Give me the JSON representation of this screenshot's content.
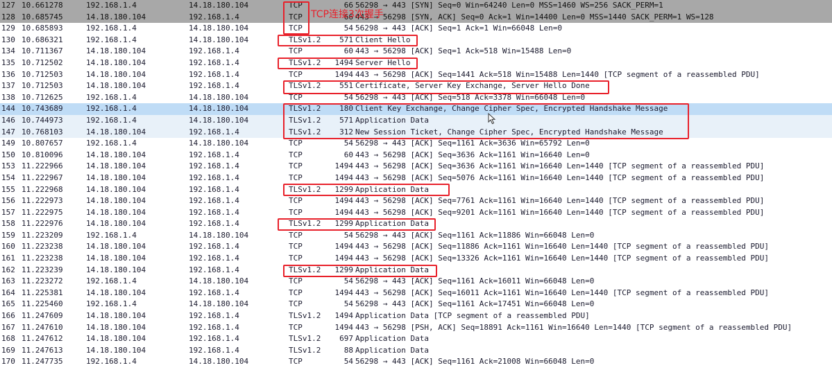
{
  "packets": [
    {
      "no": "127",
      "time": "10.661278",
      "src": "192.168.1.4",
      "dst": "14.18.180.104",
      "proto": "TCP",
      "len": "66",
      "info": "56298 → 443 [SYN] Seq=0 Win=64240 Len=0 MSS=1460 WS=256 SACK_PERM=1",
      "style": "gray"
    },
    {
      "no": "128",
      "time": "10.685745",
      "src": "14.18.180.104",
      "dst": "192.168.1.4",
      "proto": "TCP",
      "len": "66",
      "info": "443 → 56298 [SYN, ACK] Seq=0 Ack=1 Win=14400 Len=0 MSS=1440 SACK_PERM=1 WS=128",
      "style": "gray"
    },
    {
      "no": "129",
      "time": "10.685893",
      "src": "192.168.1.4",
      "dst": "14.18.180.104",
      "proto": "TCP",
      "len": "54",
      "info": "56298 → 443 [ACK] Seq=1 Ack=1 Win=66048 Len=0",
      "style": ""
    },
    {
      "no": "130",
      "time": "10.686321",
      "src": "192.168.1.4",
      "dst": "14.18.180.104",
      "proto": "TLSv1.2",
      "len": "571",
      "info": "Client Hello",
      "style": ""
    },
    {
      "no": "134",
      "time": "10.711367",
      "src": "14.18.180.104",
      "dst": "192.168.1.4",
      "proto": "TCP",
      "len": "60",
      "info": "443 → 56298 [ACK] Seq=1 Ack=518 Win=15488 Len=0",
      "style": ""
    },
    {
      "no": "135",
      "time": "10.712502",
      "src": "14.18.180.104",
      "dst": "192.168.1.4",
      "proto": "TLSv1.2",
      "len": "1494",
      "info": "Server Hello",
      "style": ""
    },
    {
      "no": "136",
      "time": "10.712503",
      "src": "14.18.180.104",
      "dst": "192.168.1.4",
      "proto": "TCP",
      "len": "1494",
      "info": "443 → 56298 [ACK] Seq=1441 Ack=518 Win=15488 Len=1440 [TCP segment of a reassembled PDU]",
      "style": ""
    },
    {
      "no": "137",
      "time": "10.712503",
      "src": "14.18.180.104",
      "dst": "192.168.1.4",
      "proto": "TLSv1.2",
      "len": "551",
      "info": "Certificate, Server Key Exchange, Server Hello Done",
      "style": ""
    },
    {
      "no": "138",
      "time": "10.712625",
      "src": "192.168.1.4",
      "dst": "14.18.180.104",
      "proto": "TCP",
      "len": "54",
      "info": "56298 → 443 [ACK] Seq=518 Ack=3378 Win=66048 Len=0",
      "style": ""
    },
    {
      "no": "144",
      "time": "10.743689",
      "src": "192.168.1.4",
      "dst": "14.18.180.104",
      "proto": "TLSv1.2",
      "len": "180",
      "info": "Client Key Exchange, Change Cipher Spec, Encrypted Handshake Message",
      "style": "sel"
    },
    {
      "no": "146",
      "time": "10.744973",
      "src": "192.168.1.4",
      "dst": "14.18.180.104",
      "proto": "TLSv1.2",
      "len": "571",
      "info": "Application Data",
      "style": "tint"
    },
    {
      "no": "147",
      "time": "10.768103",
      "src": "14.18.180.104",
      "dst": "192.168.1.4",
      "proto": "TLSv1.2",
      "len": "312",
      "info": "New Session Ticket, Change Cipher Spec, Encrypted Handshake Message",
      "style": "tint"
    },
    {
      "no": "149",
      "time": "10.807657",
      "src": "192.168.1.4",
      "dst": "14.18.180.104",
      "proto": "TCP",
      "len": "54",
      "info": "56298 → 443 [ACK] Seq=1161 Ack=3636 Win=65792 Len=0",
      "style": ""
    },
    {
      "no": "150",
      "time": "10.810096",
      "src": "14.18.180.104",
      "dst": "192.168.1.4",
      "proto": "TCP",
      "len": "60",
      "info": "443 → 56298 [ACK] Seq=3636 Ack=1161 Win=16640 Len=0",
      "style": ""
    },
    {
      "no": "153",
      "time": "11.222966",
      "src": "14.18.180.104",
      "dst": "192.168.1.4",
      "proto": "TCP",
      "len": "1494",
      "info": "443 → 56298 [ACK] Seq=3636 Ack=1161 Win=16640 Len=1440 [TCP segment of a reassembled PDU]",
      "style": ""
    },
    {
      "no": "154",
      "time": "11.222967",
      "src": "14.18.180.104",
      "dst": "192.168.1.4",
      "proto": "TCP",
      "len": "1494",
      "info": "443 → 56298 [ACK] Seq=5076 Ack=1161 Win=16640 Len=1440 [TCP segment of a reassembled PDU]",
      "style": ""
    },
    {
      "no": "155",
      "time": "11.222968",
      "src": "14.18.180.104",
      "dst": "192.168.1.4",
      "proto": "TLSv1.2",
      "len": "1299",
      "info": "Application Data",
      "style": ""
    },
    {
      "no": "156",
      "time": "11.222973",
      "src": "14.18.180.104",
      "dst": "192.168.1.4",
      "proto": "TCP",
      "len": "1494",
      "info": "443 → 56298 [ACK] Seq=7761 Ack=1161 Win=16640 Len=1440 [TCP segment of a reassembled PDU]",
      "style": ""
    },
    {
      "no": "157",
      "time": "11.222975",
      "src": "14.18.180.104",
      "dst": "192.168.1.4",
      "proto": "TCP",
      "len": "1494",
      "info": "443 → 56298 [ACK] Seq=9201 Ack=1161 Win=16640 Len=1440 [TCP segment of a reassembled PDU]",
      "style": ""
    },
    {
      "no": "158",
      "time": "11.222976",
      "src": "14.18.180.104",
      "dst": "192.168.1.4",
      "proto": "TLSv1.2",
      "len": "1299",
      "info": "Application Data",
      "style": ""
    },
    {
      "no": "159",
      "time": "11.223209",
      "src": "192.168.1.4",
      "dst": "14.18.180.104",
      "proto": "TCP",
      "len": "54",
      "info": "56298 → 443 [ACK] Seq=1161 Ack=11886 Win=66048 Len=0",
      "style": ""
    },
    {
      "no": "160",
      "time": "11.223238",
      "src": "14.18.180.104",
      "dst": "192.168.1.4",
      "proto": "TCP",
      "len": "1494",
      "info": "443 → 56298 [ACK] Seq=11886 Ack=1161 Win=16640 Len=1440 [TCP segment of a reassembled PDU]",
      "style": ""
    },
    {
      "no": "161",
      "time": "11.223238",
      "src": "14.18.180.104",
      "dst": "192.168.1.4",
      "proto": "TCP",
      "len": "1494",
      "info": "443 → 56298 [ACK] Seq=13326 Ack=1161 Win=16640 Len=1440 [TCP segment of a reassembled PDU]",
      "style": ""
    },
    {
      "no": "162",
      "time": "11.223239",
      "src": "14.18.180.104",
      "dst": "192.168.1.4",
      "proto": "TLSv1.2",
      "len": "1299",
      "info": "Application Data",
      "style": ""
    },
    {
      "no": "163",
      "time": "11.223272",
      "src": "192.168.1.4",
      "dst": "14.18.180.104",
      "proto": "TCP",
      "len": "54",
      "info": "56298 → 443 [ACK] Seq=1161 Ack=16011 Win=66048 Len=0",
      "style": ""
    },
    {
      "no": "164",
      "time": "11.225381",
      "src": "14.18.180.104",
      "dst": "192.168.1.4",
      "proto": "TCP",
      "len": "1494",
      "info": "443 → 56298 [ACK] Seq=16011 Ack=1161 Win=16640 Len=1440 [TCP segment of a reassembled PDU]",
      "style": ""
    },
    {
      "no": "165",
      "time": "11.225460",
      "src": "192.168.1.4",
      "dst": "14.18.180.104",
      "proto": "TCP",
      "len": "54",
      "info": "56298 → 443 [ACK] Seq=1161 Ack=17451 Win=66048 Len=0",
      "style": ""
    },
    {
      "no": "166",
      "time": "11.247609",
      "src": "14.18.180.104",
      "dst": "192.168.1.4",
      "proto": "TLSv1.2",
      "len": "1494",
      "info": "Application Data [TCP segment of a reassembled PDU]",
      "style": ""
    },
    {
      "no": "167",
      "time": "11.247610",
      "src": "14.18.180.104",
      "dst": "192.168.1.4",
      "proto": "TCP",
      "len": "1494",
      "info": "443 → 56298 [PSH, ACK] Seq=18891 Ack=1161 Win=16640 Len=1440 [TCP segment of a reassembled PDU]",
      "style": ""
    },
    {
      "no": "168",
      "time": "11.247612",
      "src": "14.18.180.104",
      "dst": "192.168.1.4",
      "proto": "TLSv1.2",
      "len": "697",
      "info": "Application Data",
      "style": ""
    },
    {
      "no": "169",
      "time": "11.247613",
      "src": "14.18.180.104",
      "dst": "192.168.1.4",
      "proto": "TLSv1.2",
      "len": "88",
      "info": "Application Data",
      "style": ""
    },
    {
      "no": "170",
      "time": "11.247735",
      "src": "192.168.1.4",
      "dst": "14.18.180.104",
      "proto": "TCP",
      "len": "54",
      "info": "56298 → 443 [ACK] Seq=1161 Ack=21008 Win=66048 Len=0",
      "style": ""
    }
  ],
  "annotation": {
    "text": "TCP连接3次握手",
    "color": "#e8202a"
  },
  "colors": {
    "highlight_box": "#e8202a",
    "selected_row": "#bfdcf6",
    "tint_row": "#e8f1f9",
    "syn_row": "#a8a8a8"
  }
}
